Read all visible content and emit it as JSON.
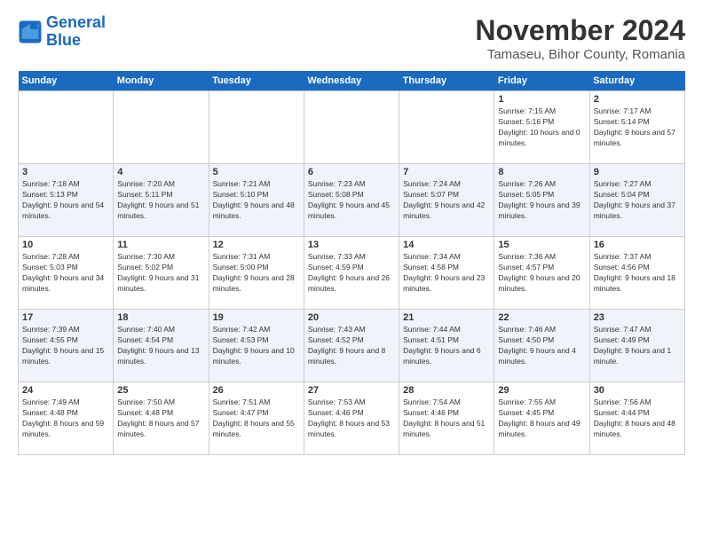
{
  "header": {
    "logo_line1": "General",
    "logo_line2": "Blue",
    "title": "November 2024",
    "subtitle": "Tamaseu, Bihor County, Romania"
  },
  "days_of_week": [
    "Sunday",
    "Monday",
    "Tuesday",
    "Wednesday",
    "Thursday",
    "Friday",
    "Saturday"
  ],
  "weeks": [
    [
      {
        "day": "",
        "info": ""
      },
      {
        "day": "",
        "info": ""
      },
      {
        "day": "",
        "info": ""
      },
      {
        "day": "",
        "info": ""
      },
      {
        "day": "",
        "info": ""
      },
      {
        "day": "1",
        "info": "Sunrise: 7:15 AM\nSunset: 5:16 PM\nDaylight: 10 hours and 0 minutes."
      },
      {
        "day": "2",
        "info": "Sunrise: 7:17 AM\nSunset: 5:14 PM\nDaylight: 9 hours and 57 minutes."
      }
    ],
    [
      {
        "day": "3",
        "info": "Sunrise: 7:18 AM\nSunset: 5:13 PM\nDaylight: 9 hours and 54 minutes."
      },
      {
        "day": "4",
        "info": "Sunrise: 7:20 AM\nSunset: 5:11 PM\nDaylight: 9 hours and 51 minutes."
      },
      {
        "day": "5",
        "info": "Sunrise: 7:21 AM\nSunset: 5:10 PM\nDaylight: 9 hours and 48 minutes."
      },
      {
        "day": "6",
        "info": "Sunrise: 7:23 AM\nSunset: 5:08 PM\nDaylight: 9 hours and 45 minutes."
      },
      {
        "day": "7",
        "info": "Sunrise: 7:24 AM\nSunset: 5:07 PM\nDaylight: 9 hours and 42 minutes."
      },
      {
        "day": "8",
        "info": "Sunrise: 7:26 AM\nSunset: 5:05 PM\nDaylight: 9 hours and 39 minutes."
      },
      {
        "day": "9",
        "info": "Sunrise: 7:27 AM\nSunset: 5:04 PM\nDaylight: 9 hours and 37 minutes."
      }
    ],
    [
      {
        "day": "10",
        "info": "Sunrise: 7:28 AM\nSunset: 5:03 PM\nDaylight: 9 hours and 34 minutes."
      },
      {
        "day": "11",
        "info": "Sunrise: 7:30 AM\nSunset: 5:02 PM\nDaylight: 9 hours and 31 minutes."
      },
      {
        "day": "12",
        "info": "Sunrise: 7:31 AM\nSunset: 5:00 PM\nDaylight: 9 hours and 28 minutes."
      },
      {
        "day": "13",
        "info": "Sunrise: 7:33 AM\nSunset: 4:59 PM\nDaylight: 9 hours and 26 minutes."
      },
      {
        "day": "14",
        "info": "Sunrise: 7:34 AM\nSunset: 4:58 PM\nDaylight: 9 hours and 23 minutes."
      },
      {
        "day": "15",
        "info": "Sunrise: 7:36 AM\nSunset: 4:57 PM\nDaylight: 9 hours and 20 minutes."
      },
      {
        "day": "16",
        "info": "Sunrise: 7:37 AM\nSunset: 4:56 PM\nDaylight: 9 hours and 18 minutes."
      }
    ],
    [
      {
        "day": "17",
        "info": "Sunrise: 7:39 AM\nSunset: 4:55 PM\nDaylight: 9 hours and 15 minutes."
      },
      {
        "day": "18",
        "info": "Sunrise: 7:40 AM\nSunset: 4:54 PM\nDaylight: 9 hours and 13 minutes."
      },
      {
        "day": "19",
        "info": "Sunrise: 7:42 AM\nSunset: 4:53 PM\nDaylight: 9 hours and 10 minutes."
      },
      {
        "day": "20",
        "info": "Sunrise: 7:43 AM\nSunset: 4:52 PM\nDaylight: 9 hours and 8 minutes."
      },
      {
        "day": "21",
        "info": "Sunrise: 7:44 AM\nSunset: 4:51 PM\nDaylight: 9 hours and 6 minutes."
      },
      {
        "day": "22",
        "info": "Sunrise: 7:46 AM\nSunset: 4:50 PM\nDaylight: 9 hours and 4 minutes."
      },
      {
        "day": "23",
        "info": "Sunrise: 7:47 AM\nSunset: 4:49 PM\nDaylight: 9 hours and 1 minute."
      }
    ],
    [
      {
        "day": "24",
        "info": "Sunrise: 7:49 AM\nSunset: 4:48 PM\nDaylight: 8 hours and 59 minutes."
      },
      {
        "day": "25",
        "info": "Sunrise: 7:50 AM\nSunset: 4:48 PM\nDaylight: 8 hours and 57 minutes."
      },
      {
        "day": "26",
        "info": "Sunrise: 7:51 AM\nSunset: 4:47 PM\nDaylight: 8 hours and 55 minutes."
      },
      {
        "day": "27",
        "info": "Sunrise: 7:53 AM\nSunset: 4:46 PM\nDaylight: 8 hours and 53 minutes."
      },
      {
        "day": "28",
        "info": "Sunrise: 7:54 AM\nSunset: 4:46 PM\nDaylight: 8 hours and 51 minutes."
      },
      {
        "day": "29",
        "info": "Sunrise: 7:55 AM\nSunset: 4:45 PM\nDaylight: 8 hours and 49 minutes."
      },
      {
        "day": "30",
        "info": "Sunrise: 7:56 AM\nSunset: 4:44 PM\nDaylight: 8 hours and 48 minutes."
      }
    ]
  ]
}
